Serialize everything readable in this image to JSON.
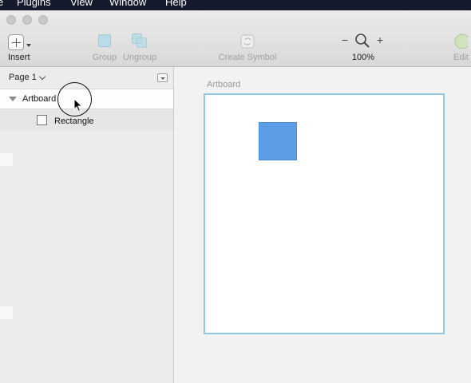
{
  "menubar": {
    "items": [
      "e",
      "Plugins",
      "View",
      "Window",
      "Help"
    ]
  },
  "toolbar": {
    "insert_label": "Insert",
    "group_label": "Group",
    "ungroup_label": "Ungroup",
    "create_symbol_label": "Create Symbol",
    "zoom_out_symbol": "−",
    "zoom_in_symbol": "+",
    "zoom_level": "100%",
    "edit_label": "Edit"
  },
  "sidebar": {
    "page_label": "Page 1",
    "layers": [
      {
        "label": "Artboard",
        "type": "artboard"
      },
      {
        "label": "Rectangle",
        "type": "rectangle"
      }
    ]
  },
  "canvas": {
    "artboard_title": "Artboard"
  },
  "colors": {
    "rectangle_fill": "#5b9ee6",
    "artboard_border": "#8fc9e2",
    "menubar_bg": "#141a2b"
  }
}
